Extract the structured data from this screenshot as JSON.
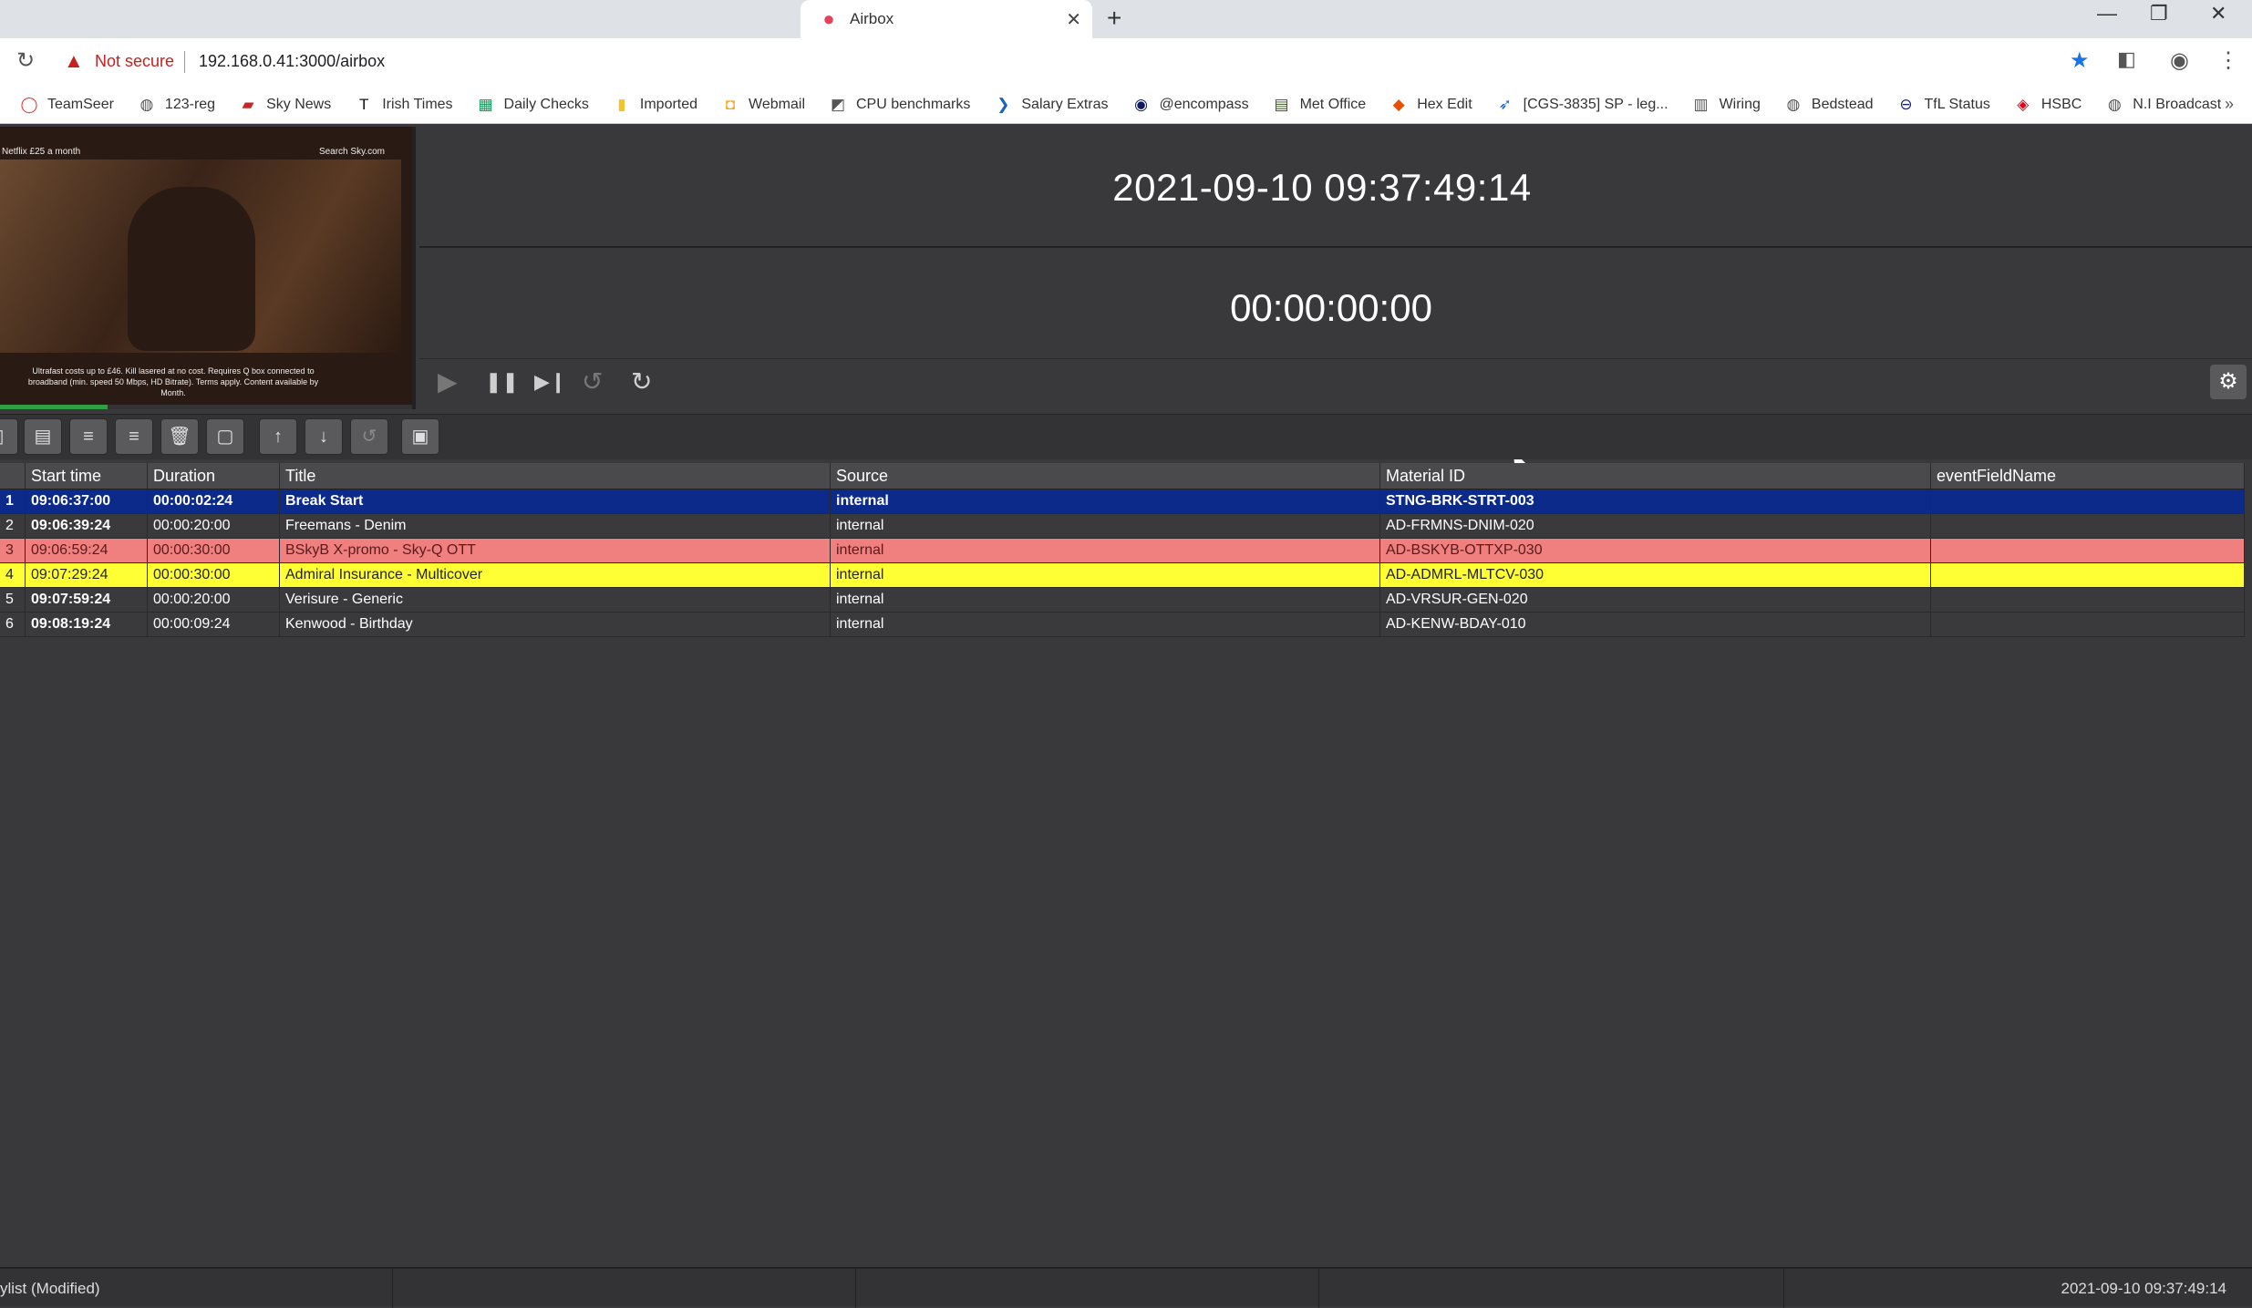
{
  "browser": {
    "tab_title": "Airbox",
    "tab_close": "✕",
    "new_tab": "+",
    "window_minimize": "—",
    "window_restore": "❐",
    "window_close": "✕",
    "security_label": "Not secure",
    "url": "192.168.0.41:3000/airbox",
    "bookmarks": [
      {
        "label": "TeamSeer",
        "icon": "teamseer-icon",
        "glyph": "◯",
        "color": "#e53935"
      },
      {
        "label": "123-reg",
        "icon": "globe-icon",
        "glyph": "◍",
        "color": "#555555"
      },
      {
        "label": "Sky News",
        "icon": "sky-news-icon",
        "glyph": "▰",
        "color": "#c62828"
      },
      {
        "label": "Irish Times",
        "icon": "irish-times-icon",
        "glyph": "T",
        "color": "#111111"
      },
      {
        "label": "Daily Checks",
        "icon": "sheets-icon",
        "glyph": "▦",
        "color": "#0f9d58"
      },
      {
        "label": "Imported",
        "icon": "folder-icon",
        "glyph": "▮",
        "color": "#f4c430"
      },
      {
        "label": "Webmail",
        "icon": "webmail-icon",
        "glyph": "◘",
        "color": "#f9a825"
      },
      {
        "label": "CPU benchmarks",
        "icon": "cpu-icon",
        "glyph": "◩",
        "color": "#555555"
      },
      {
        "label": "Salary Extras",
        "icon": "salary-icon",
        "glyph": "❯",
        "color": "#1565c0"
      },
      {
        "label": "@encompass",
        "icon": "encompass-icon",
        "glyph": "◉",
        "color": "#0d1b5e"
      },
      {
        "label": "Met Office",
        "icon": "met-office-icon",
        "glyph": "▤",
        "color": "#3a5a1a"
      },
      {
        "label": "Hex Edit",
        "icon": "html-icon",
        "glyph": "◆",
        "color": "#e65100"
      },
      {
        "label": "[CGS-3835] SP - leg...",
        "icon": "jira-icon",
        "glyph": "➶",
        "color": "#1565c0"
      },
      {
        "label": "Wiring",
        "icon": "wiring-icon",
        "glyph": "▥",
        "color": "#555555"
      },
      {
        "label": "Bedstead",
        "icon": "globe-icon",
        "glyph": "◍",
        "color": "#555555"
      },
      {
        "label": "TfL Status",
        "icon": "tfl-icon",
        "glyph": "⊖",
        "color": "#1a237e"
      },
      {
        "label": "HSBC",
        "icon": "hsbc-icon",
        "glyph": "◈",
        "color": "#db0011"
      },
      {
        "label": "N.I Broadcast",
        "icon": "globe-icon",
        "glyph": "◍",
        "color": "#555555"
      }
    ],
    "bookmarks_more": "»"
  },
  "preview": {
    "top_left_text": "Netflix £25 a month",
    "top_right_text": "Search Sky.com",
    "fine_print": "Ultrafast costs up to £46. Kill lasered at no cost. Requires Q box connected to broadband (min. speed 50 Mbps, HD Bitrate). Terms apply. Content available by Month.",
    "progress": 0.26
  },
  "clock": "2021-09-10 09:37:49:14",
  "countdown": "00:00:00:00",
  "transport": {
    "play": "▶",
    "pause": "❚❚",
    "skip": "▶❙",
    "undo": "↺",
    "redo": "↻",
    "settings": "⚙"
  },
  "toolbar_glyphs": [
    "▯",
    "▤",
    "≡",
    "≡",
    "🗑",
    "▢",
    "↑",
    "↓",
    "↺",
    "▣"
  ],
  "table": {
    "headers": [
      "",
      "Start time",
      "Duration",
      "Title",
      "Source",
      "Material ID",
      "eventFieldName"
    ],
    "rows": [
      {
        "n": "1",
        "start": "09:06:37:00",
        "duration": "00:00:02:24",
        "title": "Break Start",
        "source": "internal",
        "material": "STNG-BRK-STRT-003",
        "event": "",
        "state": "playing"
      },
      {
        "n": "2",
        "start": "09:06:39:24",
        "duration": "00:00:20:00",
        "title": "Freemans - Denim",
        "source": "internal",
        "material": "AD-FRMNS-DNIM-020",
        "event": "",
        "state": "normal"
      },
      {
        "n": "3",
        "start": "09:06:59:24",
        "duration": "00:00:30:00",
        "title": "BSkyB X-promo - Sky-Q OTT",
        "source": "internal",
        "material": "AD-BSKYB-OTTXP-030",
        "event": "",
        "state": "error"
      },
      {
        "n": "4",
        "start": "09:07:29:24",
        "duration": "00:00:30:00",
        "title": "Admiral Insurance - Multicover",
        "source": "internal",
        "material": "AD-ADMRL-MLTCV-030",
        "event": "",
        "state": "warn"
      },
      {
        "n": "5",
        "start": "09:07:59:24",
        "duration": "00:00:20:00",
        "title": "Verisure - Generic",
        "source": "internal",
        "material": "AD-VRSUR-GEN-020",
        "event": "",
        "state": "normal"
      },
      {
        "n": "6",
        "start": "09:08:19:24",
        "duration": "00:00:09:24",
        "title": "Kenwood - Birthday",
        "source": "internal",
        "material": "AD-KENW-BDAY-010",
        "event": "",
        "state": "normal"
      }
    ]
  },
  "statusbar": {
    "left": "ylist (Modified)",
    "right": "2021-09-10 09:37:49:14"
  }
}
